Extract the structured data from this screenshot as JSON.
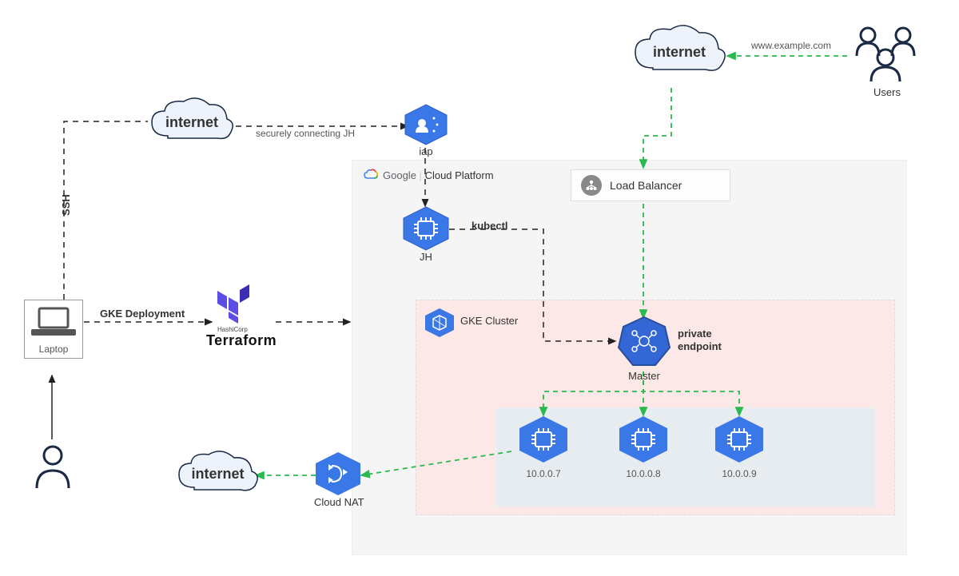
{
  "clouds": {
    "internet1": "internet",
    "internet2": "internet",
    "internet3": "internet"
  },
  "labels": {
    "ssh": "SSH",
    "gke_deploy": "GKE Deployment",
    "securely": "securely connecting JH",
    "iap": "iap",
    "jh": "JH",
    "kubectl": "kubectl",
    "gcp": "Google Cloud Platform",
    "gcp_word_google": "Google",
    "gcp_word_rest": "Cloud Platform",
    "gke_cluster": "GKE Cluster",
    "private_endpoint": "private endpoint",
    "master": "Master",
    "lb": "Load Balancer",
    "users": "Users",
    "www": "www.example.com",
    "laptop": "Laptop",
    "terraform": "Terraform",
    "terraform_sub": "HashiCorp",
    "cloud_nat": "Cloud NAT",
    "node1": "10.0.0.7",
    "node2": "10.0.0.8",
    "node3": "10.0.0.9"
  }
}
